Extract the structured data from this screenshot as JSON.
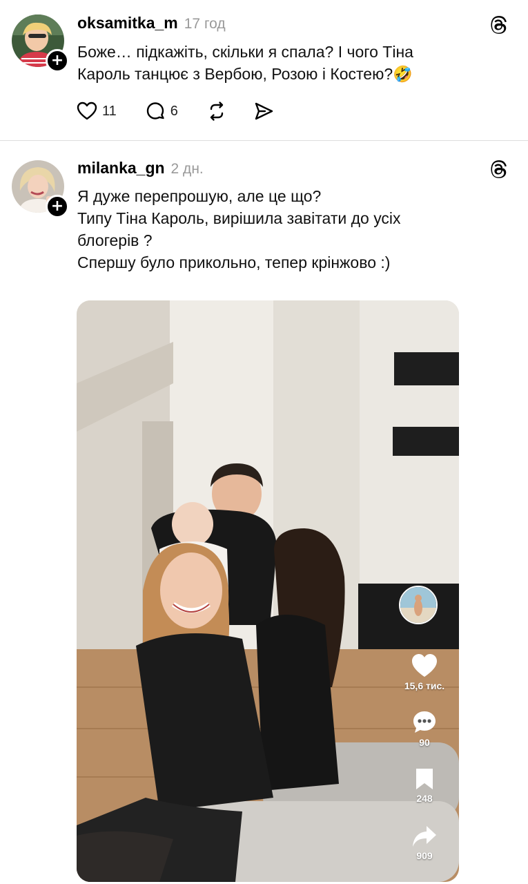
{
  "posts": [
    {
      "username": "oksamitka_m",
      "time": "17 год",
      "lines": [
        "Боже… підкажіть, скільки я спала? І чого Тіна",
        "Кароль танцює з Вербою, Розою і Костею?🤣"
      ],
      "stats": {
        "likes": "11",
        "replies": "6"
      }
    },
    {
      "username": "milanka_gn",
      "time": "2 дн.",
      "lines": [
        "Я дуже перепрошую, але це що?",
        "Типу Тіна Кароль, вирішила завітати до усіх",
        "блогерів ?",
        "Спершу було прикольно, тепер крінжово :)"
      ],
      "video": {
        "likes": "15,6 тис.",
        "comments": "90",
        "saves": "248",
        "shares": "909"
      }
    }
  ],
  "icons": {
    "threads": "threads-logo-icon",
    "like": "heart-icon",
    "reply": "comment-bubble-icon",
    "repost": "repost-icon",
    "share": "send-icon",
    "follow": "plus-icon"
  },
  "colors": {
    "text": "#000000",
    "muted": "#999999",
    "divider": "#dedede",
    "badge": "#000000"
  }
}
